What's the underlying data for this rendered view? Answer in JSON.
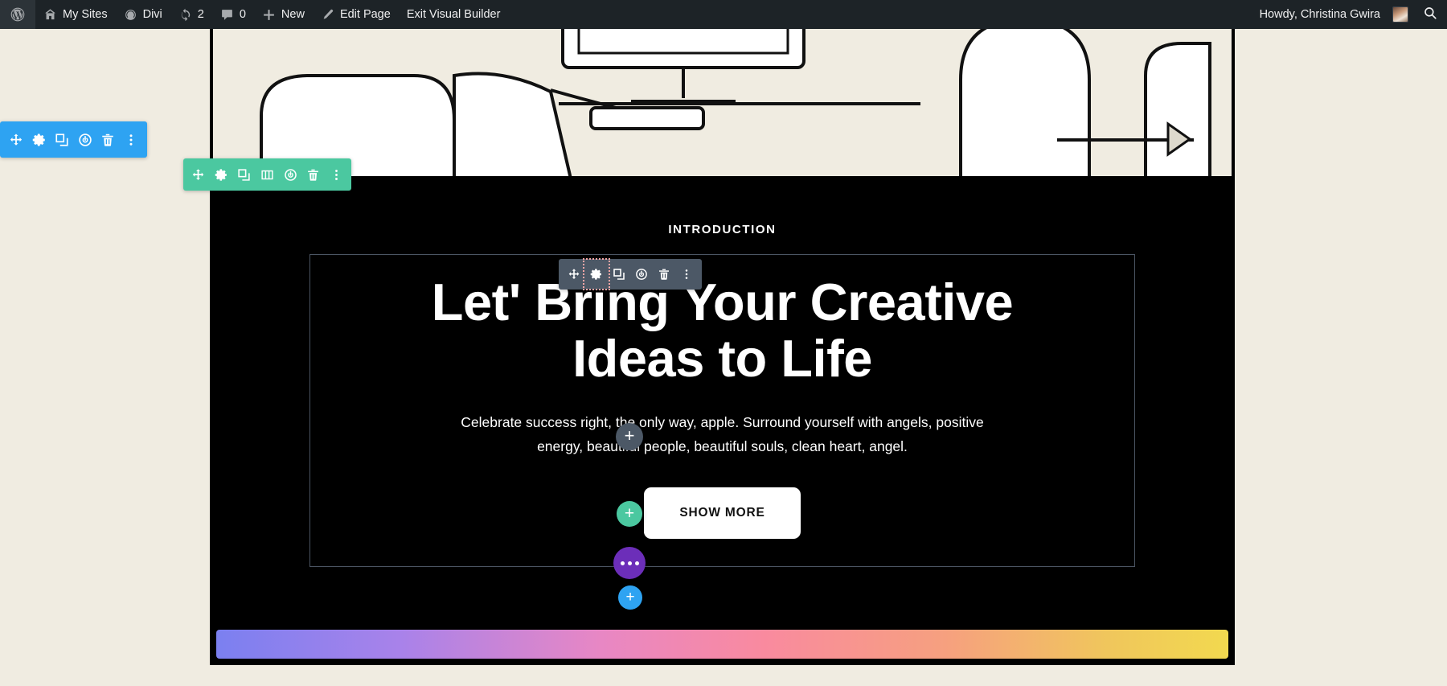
{
  "adminbar": {
    "left_items": [
      {
        "icon": "wordpress-logo-icon",
        "label": ""
      },
      {
        "icon": "my-sites-icon",
        "label": "My Sites"
      },
      {
        "icon": "divi-icon",
        "label": "Divi"
      },
      {
        "icon": "updates-icon",
        "label": "2"
      },
      {
        "icon": "comments-icon",
        "label": "0"
      },
      {
        "icon": "plus-icon",
        "label": "New"
      },
      {
        "icon": "pencil-icon",
        "label": "Edit Page"
      },
      {
        "icon": "",
        "label": "Exit Visual Builder"
      }
    ],
    "howdy": "Howdy, Christina Gwira",
    "search_icon": "search-icon"
  },
  "hero": {
    "eyebrow": "INTRODUCTION",
    "heading_line1": "Let' Bring Your Creative",
    "heading_line2": "Ideas to Life",
    "paragraph": "Celebrate success right, the only way, apple. Surround yourself with angels, positive energy, beautiful people, beautiful souls, clean heart, angel.",
    "button_label": "SHOW MORE"
  },
  "toolbars": {
    "section": {
      "name": "section-toolbar",
      "color": "#2ea3f2",
      "buttons": [
        "move-icon",
        "gear-icon",
        "duplicate-icon",
        "power-icon",
        "trash-icon",
        "kebab-icon"
      ]
    },
    "row": {
      "name": "row-toolbar",
      "color": "#4bc8a0",
      "buttons": [
        "move-icon",
        "gear-icon",
        "duplicate-icon",
        "columns-icon",
        "power-icon",
        "trash-icon",
        "kebab-icon"
      ]
    },
    "module": {
      "name": "module-toolbar",
      "color": "#4c5866",
      "active_button": "gear-icon",
      "buttons": [
        "move-icon",
        "gear-icon",
        "duplicate-icon",
        "power-icon",
        "trash-icon",
        "kebab-icon"
      ]
    }
  },
  "floating": {
    "add_row": {
      "name": "add-row-button",
      "glyph": "+",
      "color": "#4bc8a0"
    },
    "app_menu": {
      "name": "app-menu-button",
      "glyph": "…",
      "color": "#6c2eb9"
    },
    "add_section": {
      "name": "add-section-button",
      "glyph": "+",
      "color": "#2ea3f2"
    },
    "add_overlay": {
      "name": "add-module-overlay-button",
      "glyph": "+",
      "color": "#4c5866"
    }
  },
  "colors": {
    "canvas_bg": "#f0ece1",
    "hero_bg": "#000000",
    "adminbar_bg": "#1d2327",
    "gradient_start": "#7b80f0",
    "gradient_mid": "#f98a9f",
    "gradient_end": "#f2d94f"
  }
}
